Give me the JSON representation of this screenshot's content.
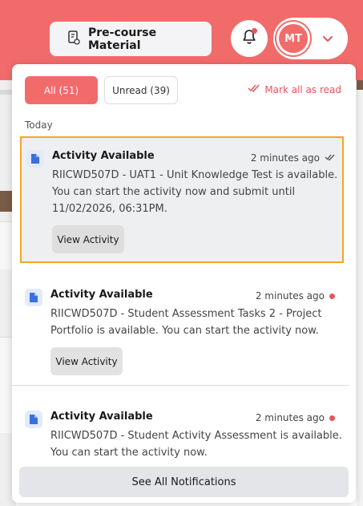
{
  "header": {
    "pre_course_label": "Pre-course Material",
    "avatar_initials": "MT"
  },
  "panel": {
    "filters": {
      "all": "All (51)",
      "unread": "Unread (39)"
    },
    "mark_all": "Mark all as read",
    "section": "Today",
    "items": [
      {
        "title": "Activity Available",
        "time": "2 minutes ago",
        "text": "RIICWD507D - UAT1 - Unit Knowledge Test is available. You can start the activity now and submit until 11/02/2026, 06:31PM.",
        "button": "View Activity",
        "status": "read"
      },
      {
        "title": "Activity Available",
        "time": "2 minutes ago",
        "text": "RIICWD507D - Student Assessment Tasks 2 - Project Portfolio is available. You can start the activity now.",
        "button": "View Activity",
        "status": "unread"
      },
      {
        "title": "Activity Available",
        "time": "2 minutes ago",
        "text": "RIICWD507D - Student Activity Assessment is available. You can start the activity now.",
        "status": "unread"
      }
    ],
    "see_all": "See All Notifications"
  },
  "colors": {
    "brand": "#f26b6b",
    "unread_dot": "#e8545a",
    "highlight_border": "#f5a623"
  }
}
